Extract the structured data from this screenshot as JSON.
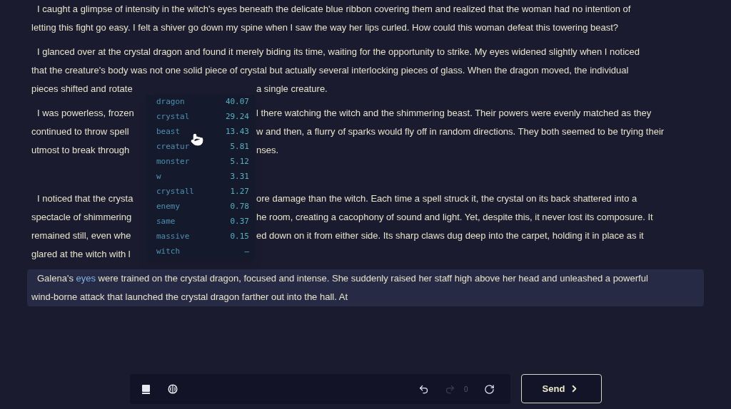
{
  "story": [
    {
      "kind": "text",
      "selected": false,
      "lines": [
        {
          "kind": "full",
          "text": "I caught a glimpse of intensity in the witch's eyes beneath the delicate blue ribbon covering them and realized that the woman had no intention of"
        },
        {
          "kind": "full",
          "text": "letting this fight go easy. I felt a shiver go down my spine when I saw the way her lips curled. How could this woman defeat this towering beast?"
        }
      ]
    },
    {
      "kind": "text",
      "selected": false,
      "lines": [
        {
          "kind": "full",
          "text": "I glanced over at the crystal dragon and found it merely biding its time, waiting for the opportunity to strike. My eyes widened slightly when I noticed"
        },
        {
          "kind": "full",
          "text": "that the creature's body was not one solid piece of crystal but actually several interlocking pieces of glass. When the dragon moved, the individual"
        },
        {
          "kind": "split",
          "left": "pieces shifted and rotate",
          "right": "a single creature."
        }
      ]
    },
    {
      "kind": "text",
      "selected": false,
      "lines": [
        {
          "kind": "split",
          "left": "I was powerless, frozen",
          "right": "l there watching the witch and the shimmering beast. Their powers were evenly matched as they"
        },
        {
          "kind": "split",
          "left": "continued to throw spell",
          "right": "w and then, a flurry of sparks would fly off in random directions. They both seemed to be trying their"
        },
        {
          "kind": "split",
          "left": "utmost to break through",
          "right": "nses."
        }
      ]
    },
    {
      "kind": "blank"
    },
    {
      "kind": "text",
      "selected": false,
      "lines": [
        {
          "kind": "split",
          "left": "I noticed that the crysta",
          "right": "ore damage than the witch. Each time a spell struck it, the crystal on its back shattered into a"
        },
        {
          "kind": "split",
          "left": "spectacle of shimmering",
          "right": "he room, creating a cacophony of sound and light. Yet, despite this, it never lost its composure. It"
        },
        {
          "kind": "split",
          "left": "remained still, even whe",
          "right": "ed down on it from either side. Its sharp claws dug deep into the carpet, holding it in place as it"
        },
        {
          "kind": "split",
          "left": "glared at the witch with l"
        }
      ]
    },
    {
      "kind": "text",
      "selected": true,
      "lines": [
        {
          "kind": "linked",
          "before": "Galena's ",
          "link": "eyes",
          "after": " were trained on the crystal dragon, focused and intense. She suddenly raised her staff high above her head and unleashed a powerful"
        },
        {
          "kind": "full",
          "text": "wind-borne attack that launched the crystal dragon farther out into the hall. At"
        }
      ]
    }
  ],
  "probabilities": [
    {
      "token": "dragon",
      "value": "40.07"
    },
    {
      "token": "crystal",
      "value": "29.24"
    },
    {
      "token": "beast",
      "value": "13.43"
    },
    {
      "token": "creatur",
      "value": "5.81"
    },
    {
      "token": "monster",
      "value": "5.12"
    },
    {
      "token": "w",
      "value": "3.31"
    },
    {
      "token": "crystall",
      "value": "1.27"
    },
    {
      "token": "enemy",
      "value": "0.78"
    },
    {
      "token": "same",
      "value": "0.37"
    },
    {
      "token": "massive",
      "value": "0.15"
    },
    {
      "token": "witch",
      "value": "–"
    }
  ],
  "toolbar": {
    "redo_disabled": true,
    "counter": "0"
  },
  "send_button": {
    "label": "Send"
  }
}
